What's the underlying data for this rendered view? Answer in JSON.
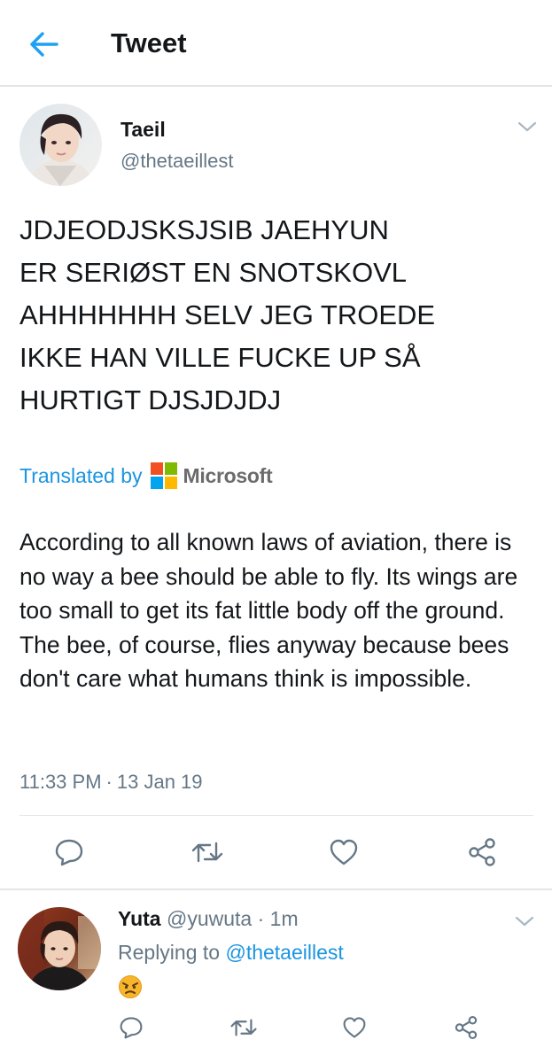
{
  "header": {
    "title": "Tweet"
  },
  "tweet": {
    "author_name": "Taeil",
    "author_handle": "@thetaeillest",
    "text": "JDJEODJSKSJSIB JAEHYUN\nER SERIØST EN SNOTSKOVL\nAHHHHHHH SELV JEG TROEDE\nIKKE HAN VILLE FUCKE UP SÅ\nHURTIGT DJSJDJDJ",
    "translated_by_label": "Translated by",
    "translator_name": "Microsoft",
    "translation": "According to all known laws of aviation, there is no way a bee should be able to fly. Its wings are too small to get its fat little body off the ground. The bee, of course, flies anyway because bees don't care what humans think is impossible.",
    "time": "11:33 PM",
    "separator": "·",
    "date": "13 Jan 19"
  },
  "reply": {
    "author_name": "Yuta",
    "author_handle": "@yuwuta",
    "separator": "·",
    "age": "1m",
    "replying_label": "Replying to",
    "replying_handle": "@thetaeillest"
  },
  "icons": {
    "back": "arrow-left-icon",
    "caret": "chevron-down-icon",
    "reply": "speech-bubble-icon",
    "retweet": "retweet-icon",
    "like": "heart-icon",
    "share": "share-icon",
    "emoji": "angry-face-emoji"
  },
  "colors": {
    "accent": "#1da1f2",
    "link": "#1b95e0",
    "text": "#14171a",
    "secondary": "#657786",
    "icon": "#657786",
    "divider": "#e3e6e8",
    "ms_red": "#f25022",
    "ms_green": "#7fba00",
    "ms_blue": "#00a4ef",
    "ms_yellow": "#ffb900"
  }
}
